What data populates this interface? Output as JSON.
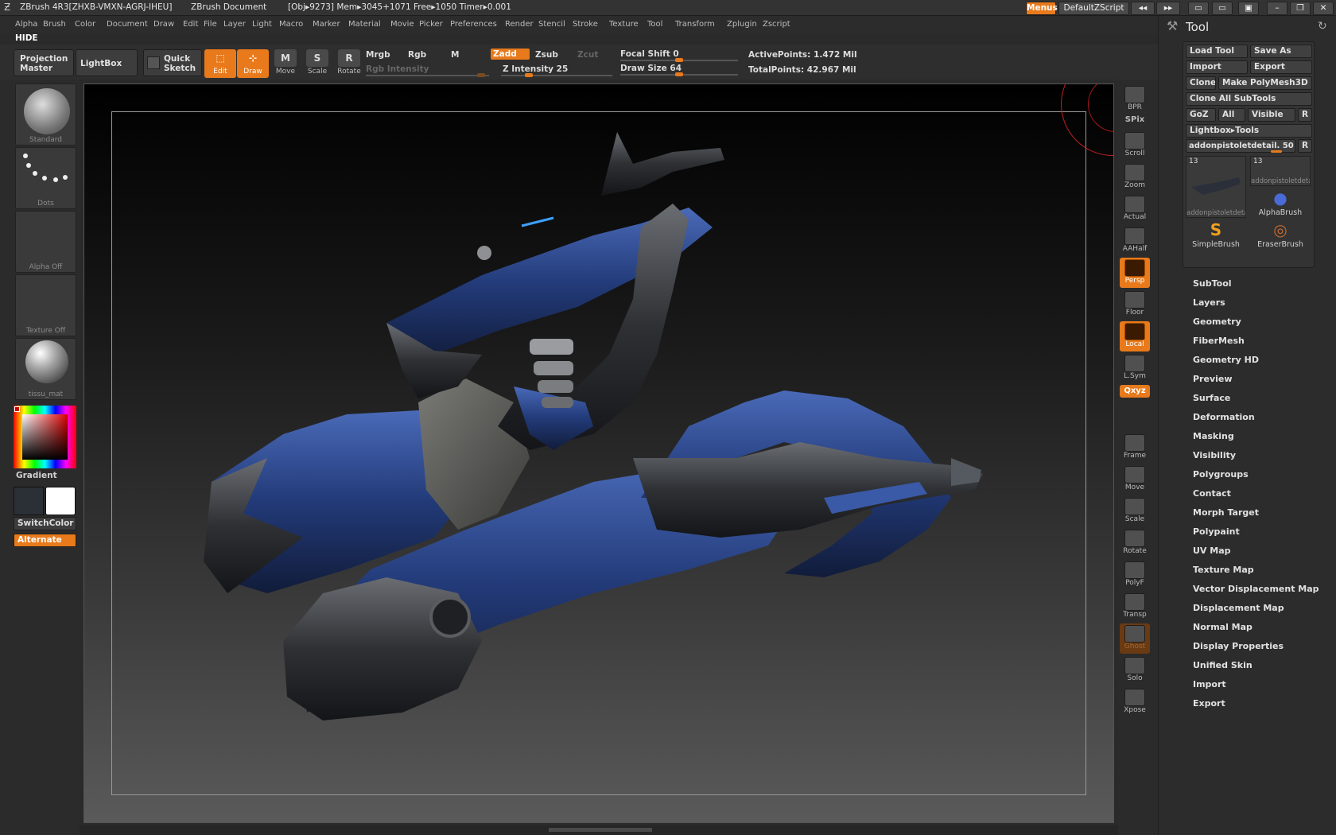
{
  "titlebar": {
    "app": "ZBrush 4R3[ZHXB-VMXN-AGRJ-IHEU]",
    "document": "ZBrush Document",
    "stats": "[Obj▸9273] Mem▸3045+1071 Free▸1050 Timer▸0.001",
    "menus_button": "Menus",
    "script_button": "DefaultZScript"
  },
  "menubar": [
    "Alpha",
    "Brush",
    "Color",
    "Document",
    "Draw",
    "Edit",
    "File",
    "Layer",
    "Light",
    "Macro",
    "Marker",
    "Material",
    "Movie",
    "Picker",
    "Preferences",
    "Render",
    "Stencil",
    "Stroke",
    "Texture",
    "Tool",
    "Transform",
    "Zplugin",
    "Zscript"
  ],
  "hide_label": "HIDE",
  "shelf": {
    "projection_master": "Projection Master",
    "lightbox": "LightBox",
    "quick_sketch": "Quick Sketch",
    "edit": "Edit",
    "draw": "Draw",
    "move": "Move",
    "scale": "Scale",
    "rotate": "Rotate",
    "mrgb": "Mrgb",
    "rgb": "Rgb",
    "m": "M",
    "rgb_intensity": "Rgb Intensity",
    "zadd": "Zadd",
    "zsub": "Zsub",
    "zcut": "Zcut",
    "z_intensity": "Z Intensity 25",
    "focal_shift": "Focal Shift 0",
    "draw_size": "Draw Size 64",
    "active_points": "ActivePoints: 1.472  Mil",
    "total_points": "TotalPoints: 42.967  Mil",
    "z_intensity_value": 25,
    "focal_shift_value": 0,
    "draw_size_value": 64
  },
  "left": {
    "brush": "Standard",
    "stroke": "Dots",
    "alpha": "Alpha  Off",
    "texture": "Texture  Off",
    "material": "tissu_mat",
    "gradient": "Gradient",
    "switch_color": "SwitchColor",
    "alternate": "Alternate"
  },
  "right_toolbar": [
    {
      "label": "BPR",
      "icon": "bpr-sphere-icon",
      "style": "normal"
    },
    {
      "label": "SPix",
      "icon": "spix-slider-icon",
      "style": "normal"
    },
    {
      "label": "Scroll",
      "icon": "scroll-icon",
      "style": "normal"
    },
    {
      "label": "Zoom",
      "icon": "zoom-icon",
      "style": "normal"
    },
    {
      "label": "Actual",
      "icon": "actual-icon",
      "style": "normal"
    },
    {
      "label": "AAHalf",
      "icon": "aahalf-icon",
      "style": "normal"
    },
    {
      "label": "Persp",
      "icon": "persp-icon",
      "style": "orange"
    },
    {
      "label": "Floor",
      "icon": "floor-icon",
      "style": "normal"
    },
    {
      "label": "Local",
      "icon": "local-icon",
      "style": "orange"
    },
    {
      "label": "L.Sym",
      "icon": "lsym-icon",
      "style": "normal"
    },
    {
      "label": "Qxyz",
      "icon": "xyz-icon",
      "style": "orange"
    },
    {
      "label": "Frame",
      "icon": "frame-icon",
      "style": "normal"
    },
    {
      "label": "Move",
      "icon": "move-icon",
      "style": "normal"
    },
    {
      "label": "Scale",
      "icon": "scale-icon",
      "style": "normal"
    },
    {
      "label": "Rotate",
      "icon": "rotate-icon",
      "style": "normal"
    },
    {
      "label": "PolyF",
      "icon": "polyf-icon",
      "style": "normal"
    },
    {
      "label": "Transp",
      "icon": "transp-icon",
      "style": "normal"
    },
    {
      "label": "Ghost",
      "icon": "ghost-icon",
      "style": "brown"
    },
    {
      "label": "Solo",
      "icon": "solo-icon",
      "style": "normal"
    },
    {
      "label": "Xpose",
      "icon": "xpose-icon",
      "style": "normal"
    }
  ],
  "tool": {
    "title": "Tool",
    "load_tool": "Load Tool",
    "save_as": "Save As",
    "import": "Import",
    "export": "Export",
    "clone": "Clone",
    "make_polymesh": "Make PolyMesh3D",
    "clone_all": "Clone  All  SubTools",
    "goz": "GoZ",
    "all": "All",
    "visible": "Visible",
    "r": "R",
    "lightbox_tools": "Lightbox▸Tools",
    "current_tool": "addonpistoletdetail. 50",
    "thumbs": [
      {
        "num": "13",
        "caption": "addonpistoletdeta"
      },
      {
        "num": "13",
        "caption": "addonpistoletdeta"
      }
    ],
    "brushes": [
      {
        "label": "AlphaBrush",
        "icon": "alphabrush-icon"
      },
      {
        "label": "SimpleBrush",
        "icon": "simplebrush-icon"
      },
      {
        "label": "EraserBrush",
        "icon": "eraserbrush-icon"
      }
    ],
    "sections": [
      "SubTool",
      "Layers",
      "Geometry",
      "FiberMesh",
      "Geometry HD",
      "Preview",
      "Surface",
      "Deformation",
      "Masking",
      "Visibility",
      "Polygroups",
      "Contact",
      "Morph Target",
      "Polypaint",
      "UV Map",
      "Texture Map",
      "Vector Displacement Map",
      "Displacement Map",
      "Normal Map",
      "Display Properties",
      "Unified Skin",
      "Import",
      "Export"
    ]
  },
  "colors": {
    "accent": "#e87a1b",
    "armor_blue": "#223a78",
    "panel": "#2c2c2c"
  }
}
